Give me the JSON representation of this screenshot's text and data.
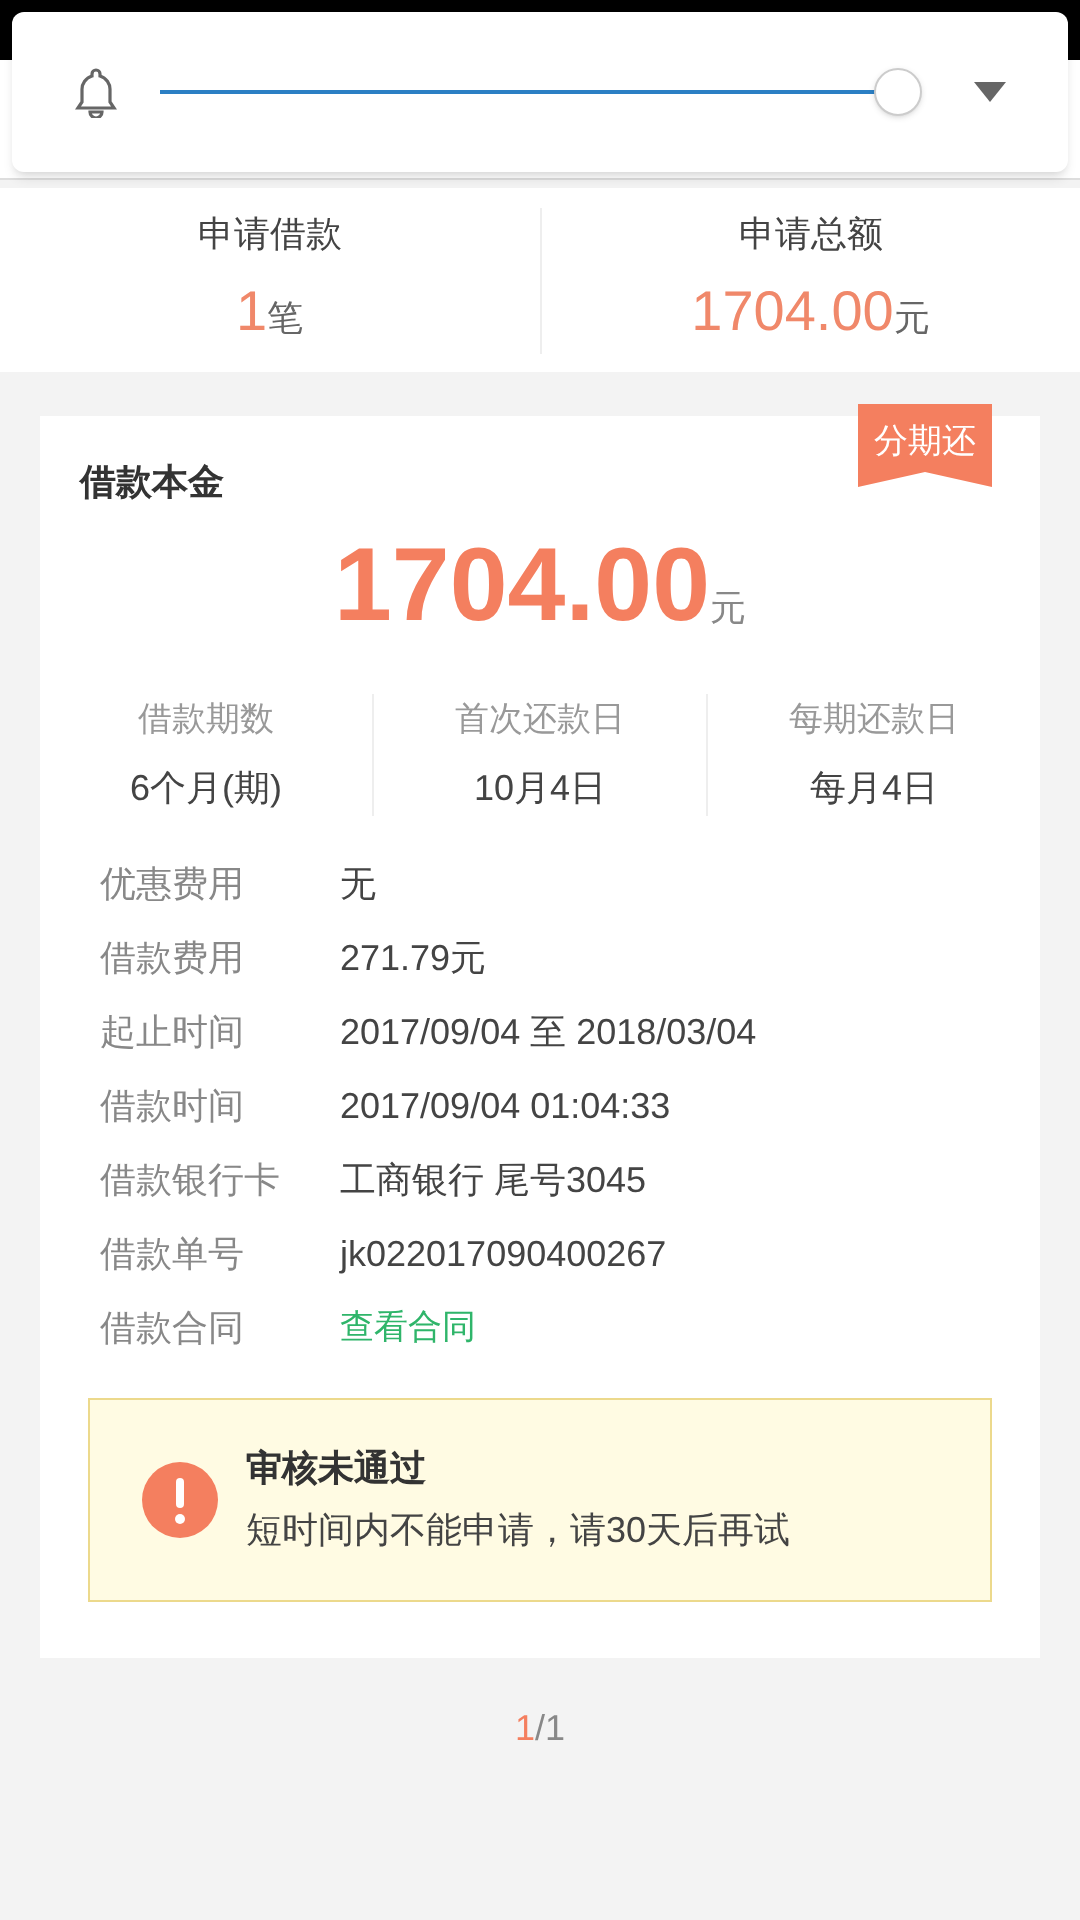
{
  "quick_panel": {
    "brightness": {
      "level": 0.97
    }
  },
  "summary": [
    {
      "label": "申请借款",
      "value": "1",
      "unit": "笔"
    },
    {
      "label": "申请总额",
      "value": "1704.00",
      "unit": "元"
    }
  ],
  "loan_card": {
    "title": "借款本金",
    "badge": "分期还",
    "amount": "1704.00",
    "unit": "元",
    "stats": [
      {
        "label": "借款期数",
        "value": "6个月(期)"
      },
      {
        "label": "首次还款日",
        "value": "10月4日"
      },
      {
        "label": "每期还款日",
        "value": "每月4日"
      }
    ],
    "details": [
      {
        "label": "优惠费用",
        "value": "无",
        "kind": "text"
      },
      {
        "label": "借款费用",
        "value": "271.79元",
        "kind": "text"
      },
      {
        "label": "起止时间",
        "value": "2017/09/04 至 2018/03/04",
        "kind": "text"
      },
      {
        "label": "借款时间",
        "value": "2017/09/04 01:04:33",
        "kind": "text"
      },
      {
        "label": "借款银行卡",
        "value": "工商银行 尾号3045",
        "kind": "text"
      },
      {
        "label": "借款单号",
        "value": "jk022017090400267",
        "kind": "text"
      },
      {
        "label": "借款合同",
        "value": "查看合同",
        "kind": "link"
      }
    ],
    "alert": {
      "title": "审核未通过",
      "message": "短时间内不能申请，请30天后再试"
    }
  },
  "pagination": {
    "current": "1",
    "total": "/1"
  }
}
